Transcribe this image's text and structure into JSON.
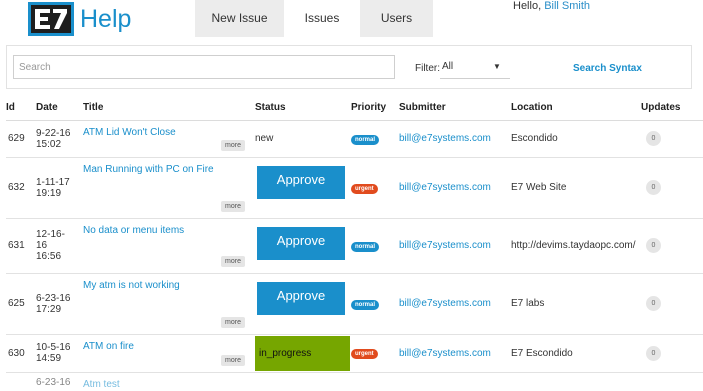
{
  "header": {
    "title": "Help",
    "nav": [
      {
        "label": "New Issue"
      },
      {
        "label": "Issues"
      },
      {
        "label": "Users"
      }
    ],
    "greeting": "Hello, ",
    "user": "Bill Smith"
  },
  "filters": {
    "search_placeholder": "Search",
    "filter_label": "Filter:",
    "filter_value": "All",
    "syntax_link": "Search Syntax"
  },
  "table": {
    "columns": [
      "Id",
      "Date",
      "Title",
      "Status",
      "Priority",
      "Submitter",
      "Location",
      "Updates"
    ],
    "more_label": "more",
    "rows": [
      {
        "id": "629",
        "date": [
          "9-22-16",
          "15:02"
        ],
        "title": "ATM Lid Won't Close",
        "status": "new",
        "status_type": "text",
        "priority": "normal",
        "submitter": "bill@e7systems.com",
        "location": "Escondido",
        "updates": "0"
      },
      {
        "id": "632",
        "date": [
          "1-11-17",
          "19:19"
        ],
        "title": "Man Running with PC on Fire",
        "status": "Approve",
        "status_type": "button",
        "priority": "urgent",
        "submitter": "bill@e7systems.com",
        "location": "E7 Web Site",
        "updates": "0"
      },
      {
        "id": "631",
        "date": [
          "12-16-",
          "16",
          "16:56"
        ],
        "title": "No data or menu items",
        "status": "Approve",
        "status_type": "button",
        "priority": "normal",
        "submitter": "bill@e7systems.com",
        "location": "http://devims.taydaopc.com/",
        "updates": "0"
      },
      {
        "id": "625",
        "date": [
          "6-23-16",
          "17:29"
        ],
        "title": "My atm is not working",
        "status": "Approve",
        "status_type": "button",
        "priority": "normal",
        "submitter": "bill@e7systems.com",
        "location": "E7 labs",
        "updates": "0"
      },
      {
        "id": "630",
        "date": [
          "10-5-16",
          "14:59"
        ],
        "title": "ATM on fire",
        "status": "in_progress",
        "status_type": "progress",
        "priority": "urgent",
        "submitter": "bill@e7systems.com",
        "location": "E7 Escondido",
        "updates": "0"
      },
      {
        "id": "",
        "date": [
          "6-23-16",
          ""
        ],
        "title": "Atm test",
        "status": "",
        "status_type": "text",
        "priority": "",
        "submitter": "",
        "location": "",
        "updates": ""
      }
    ]
  },
  "colors": {
    "accent": "#1a8fcb",
    "urgent": "#e14b1e",
    "progress": "#76a600"
  }
}
